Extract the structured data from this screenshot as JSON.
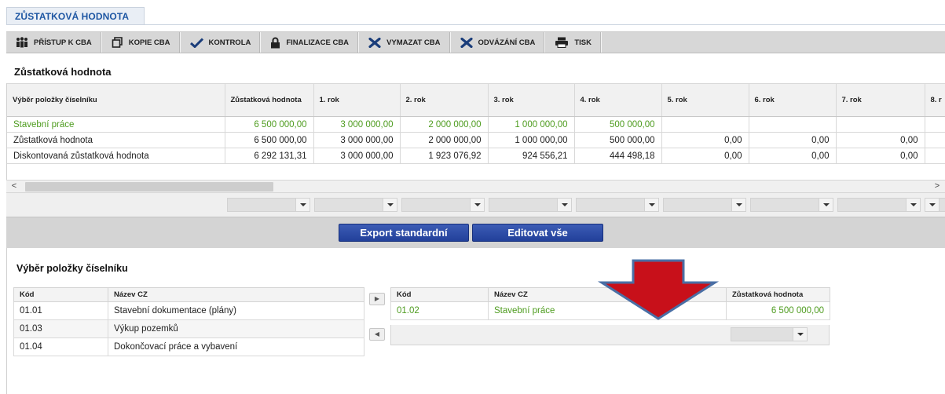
{
  "tab": {
    "title": "ZŮSTATKOVÁ HODNOTA"
  },
  "toolbar": {
    "items": [
      {
        "label": "PŘÍSTUP K CBA",
        "icon": "users-icon"
      },
      {
        "label": "KOPIE CBA",
        "icon": "copy-icon"
      },
      {
        "label": "KONTROLA",
        "icon": "check-icon"
      },
      {
        "label": "FINALIZACE CBA",
        "icon": "lock-icon"
      },
      {
        "label": "VYMAZAT CBA",
        "icon": "close-icon"
      },
      {
        "label": "ODVÁZÁNÍ CBA",
        "icon": "close-icon"
      },
      {
        "label": "TISK",
        "icon": "printer-icon"
      }
    ]
  },
  "main": {
    "title": "Zůstatková hodnota",
    "columns": [
      "Výběr položky číselníku",
      "Zůstatková hodnota",
      "1. rok",
      "2. rok",
      "3. rok",
      "4. rok",
      "5. rok",
      "6. rok",
      "7. rok",
      "8. r"
    ],
    "rows": [
      {
        "cells": [
          "Stavební práce",
          "6 500 000,00",
          "3 000 000,00",
          "2 000 000,00",
          "1 000 000,00",
          "500 000,00",
          "",
          "",
          "",
          ""
        ]
      },
      {
        "cells": [
          "Zůstatková hodnota",
          "6 500 000,00",
          "3 000 000,00",
          "2 000 000,00",
          "1 000 000,00",
          "500 000,00",
          "0,00",
          "0,00",
          "0,00",
          ""
        ]
      },
      {
        "cells": [
          "Diskontovaná zůstatková hodnota",
          "6 292 131,31",
          "3 000 000,00",
          "1 923 076,92",
          "924 556,21",
          "444 498,18",
          "0,00",
          "0,00",
          "0,00",
          ""
        ]
      }
    ],
    "scroll_left": "<",
    "scroll_right": ">"
  },
  "actions": {
    "export_label": "Export standardní",
    "edit_all_label": "Editovat vše"
  },
  "selection": {
    "title": "Výběr položky číselníku",
    "available": {
      "columns": [
        "Kód",
        "Název CZ"
      ],
      "rows": [
        [
          "01.01",
          "Stavební dokumentace (plány)"
        ],
        [
          "01.03",
          "Výkup pozemků"
        ],
        [
          "01.04",
          "Dokončovací práce a vybavení"
        ]
      ]
    },
    "selected": {
      "columns": [
        "Kód",
        "Název CZ",
        "Zůstatková hodnota"
      ],
      "rows": [
        [
          "01.02",
          "Stavební práce",
          "6 500 000,00"
        ]
      ]
    },
    "move_right": "▶",
    "move_left": "◀"
  },
  "colors": {
    "accent_blue": "#1f57a3",
    "button_blue": "#2a49a5",
    "green_text": "#4e9c1f",
    "arrow_red": "#c8101a",
    "arrow_border": "#4a6fa5"
  }
}
